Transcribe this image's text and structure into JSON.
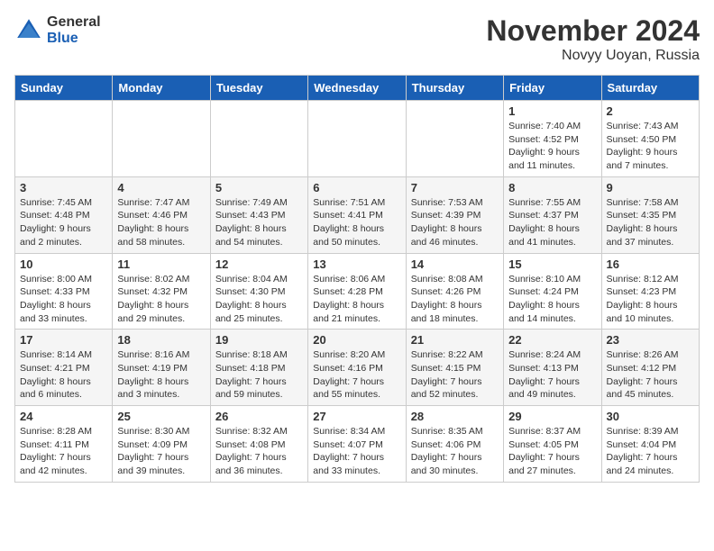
{
  "header": {
    "logo_general": "General",
    "logo_blue": "Blue",
    "month_title": "November 2024",
    "location": "Novyy Uoyan, Russia"
  },
  "days_of_week": [
    "Sunday",
    "Monday",
    "Tuesday",
    "Wednesday",
    "Thursday",
    "Friday",
    "Saturday"
  ],
  "weeks": [
    [
      {
        "day": "",
        "info": ""
      },
      {
        "day": "",
        "info": ""
      },
      {
        "day": "",
        "info": ""
      },
      {
        "day": "",
        "info": ""
      },
      {
        "day": "",
        "info": ""
      },
      {
        "day": "1",
        "info": "Sunrise: 7:40 AM\nSunset: 4:52 PM\nDaylight: 9 hours and 11 minutes."
      },
      {
        "day": "2",
        "info": "Sunrise: 7:43 AM\nSunset: 4:50 PM\nDaylight: 9 hours and 7 minutes."
      }
    ],
    [
      {
        "day": "3",
        "info": "Sunrise: 7:45 AM\nSunset: 4:48 PM\nDaylight: 9 hours and 2 minutes."
      },
      {
        "day": "4",
        "info": "Sunrise: 7:47 AM\nSunset: 4:46 PM\nDaylight: 8 hours and 58 minutes."
      },
      {
        "day": "5",
        "info": "Sunrise: 7:49 AM\nSunset: 4:43 PM\nDaylight: 8 hours and 54 minutes."
      },
      {
        "day": "6",
        "info": "Sunrise: 7:51 AM\nSunset: 4:41 PM\nDaylight: 8 hours and 50 minutes."
      },
      {
        "day": "7",
        "info": "Sunrise: 7:53 AM\nSunset: 4:39 PM\nDaylight: 8 hours and 46 minutes."
      },
      {
        "day": "8",
        "info": "Sunrise: 7:55 AM\nSunset: 4:37 PM\nDaylight: 8 hours and 41 minutes."
      },
      {
        "day": "9",
        "info": "Sunrise: 7:58 AM\nSunset: 4:35 PM\nDaylight: 8 hours and 37 minutes."
      }
    ],
    [
      {
        "day": "10",
        "info": "Sunrise: 8:00 AM\nSunset: 4:33 PM\nDaylight: 8 hours and 33 minutes."
      },
      {
        "day": "11",
        "info": "Sunrise: 8:02 AM\nSunset: 4:32 PM\nDaylight: 8 hours and 29 minutes."
      },
      {
        "day": "12",
        "info": "Sunrise: 8:04 AM\nSunset: 4:30 PM\nDaylight: 8 hours and 25 minutes."
      },
      {
        "day": "13",
        "info": "Sunrise: 8:06 AM\nSunset: 4:28 PM\nDaylight: 8 hours and 21 minutes."
      },
      {
        "day": "14",
        "info": "Sunrise: 8:08 AM\nSunset: 4:26 PM\nDaylight: 8 hours and 18 minutes."
      },
      {
        "day": "15",
        "info": "Sunrise: 8:10 AM\nSunset: 4:24 PM\nDaylight: 8 hours and 14 minutes."
      },
      {
        "day": "16",
        "info": "Sunrise: 8:12 AM\nSunset: 4:23 PM\nDaylight: 8 hours and 10 minutes."
      }
    ],
    [
      {
        "day": "17",
        "info": "Sunrise: 8:14 AM\nSunset: 4:21 PM\nDaylight: 8 hours and 6 minutes."
      },
      {
        "day": "18",
        "info": "Sunrise: 8:16 AM\nSunset: 4:19 PM\nDaylight: 8 hours and 3 minutes."
      },
      {
        "day": "19",
        "info": "Sunrise: 8:18 AM\nSunset: 4:18 PM\nDaylight: 7 hours and 59 minutes."
      },
      {
        "day": "20",
        "info": "Sunrise: 8:20 AM\nSunset: 4:16 PM\nDaylight: 7 hours and 55 minutes."
      },
      {
        "day": "21",
        "info": "Sunrise: 8:22 AM\nSunset: 4:15 PM\nDaylight: 7 hours and 52 minutes."
      },
      {
        "day": "22",
        "info": "Sunrise: 8:24 AM\nSunset: 4:13 PM\nDaylight: 7 hours and 49 minutes."
      },
      {
        "day": "23",
        "info": "Sunrise: 8:26 AM\nSunset: 4:12 PM\nDaylight: 7 hours and 45 minutes."
      }
    ],
    [
      {
        "day": "24",
        "info": "Sunrise: 8:28 AM\nSunset: 4:11 PM\nDaylight: 7 hours and 42 minutes."
      },
      {
        "day": "25",
        "info": "Sunrise: 8:30 AM\nSunset: 4:09 PM\nDaylight: 7 hours and 39 minutes."
      },
      {
        "day": "26",
        "info": "Sunrise: 8:32 AM\nSunset: 4:08 PM\nDaylight: 7 hours and 36 minutes."
      },
      {
        "day": "27",
        "info": "Sunrise: 8:34 AM\nSunset: 4:07 PM\nDaylight: 7 hours and 33 minutes."
      },
      {
        "day": "28",
        "info": "Sunrise: 8:35 AM\nSunset: 4:06 PM\nDaylight: 7 hours and 30 minutes."
      },
      {
        "day": "29",
        "info": "Sunrise: 8:37 AM\nSunset: 4:05 PM\nDaylight: 7 hours and 27 minutes."
      },
      {
        "day": "30",
        "info": "Sunrise: 8:39 AM\nSunset: 4:04 PM\nDaylight: 7 hours and 24 minutes."
      }
    ]
  ]
}
